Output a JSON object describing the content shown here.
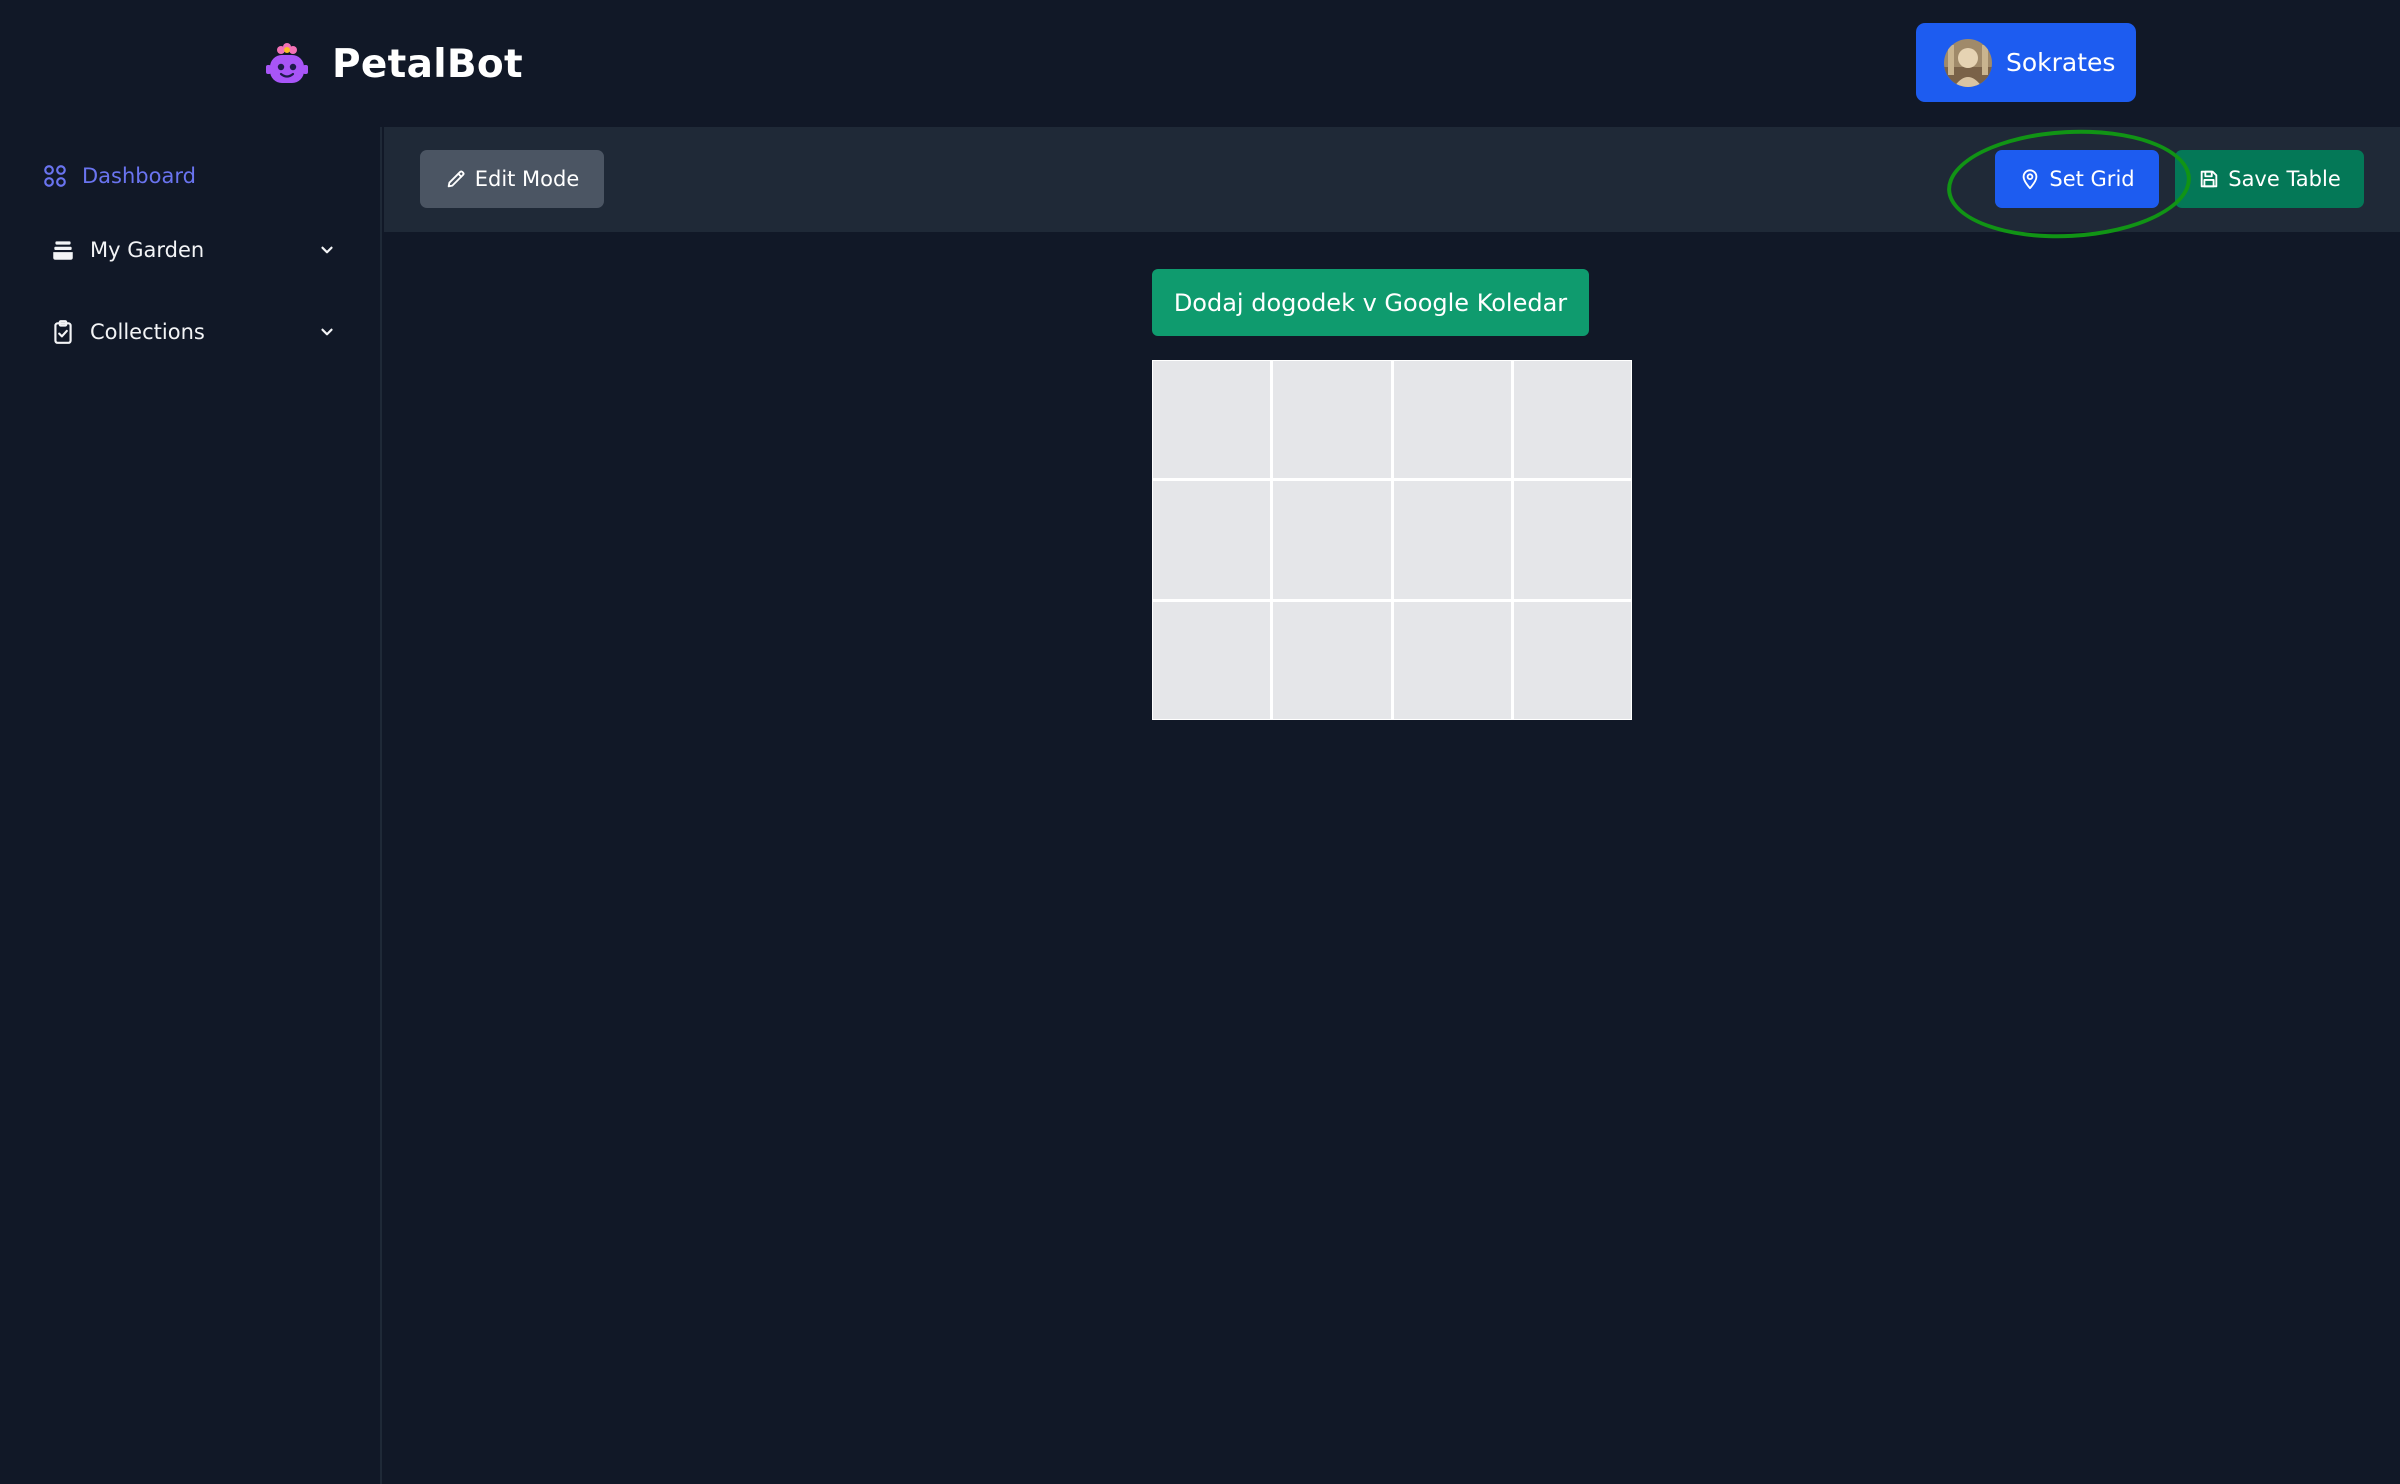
{
  "app": {
    "name": "PetalBot",
    "logo_icon": "robot-flower-icon"
  },
  "user": {
    "name": "Sokrates",
    "avatar_icon": "user-avatar"
  },
  "sidebar": {
    "items": [
      {
        "label": "Dashboard",
        "icon": "grid-icon",
        "active": true
      },
      {
        "label": "My Garden",
        "icon": "planter-icon",
        "expandable": true
      },
      {
        "label": "Collections",
        "icon": "clipboard-icon",
        "expandable": true
      }
    ]
  },
  "toolbar": {
    "edit_label": "Edit Mode",
    "set_grid_label": "Set Grid",
    "save_label": "Save Table"
  },
  "main": {
    "calendar_button_label": "Dodaj dogodek v Google Koledar",
    "grid": {
      "rows": 3,
      "cols": 4
    }
  },
  "colors": {
    "background": "#111827",
    "toolbar": "#1f2937",
    "primary": "#1d5cf0",
    "success": "#047857",
    "calendar": "#0f9b6e",
    "active_nav": "#6a74f0",
    "highlight": "#119415"
  }
}
